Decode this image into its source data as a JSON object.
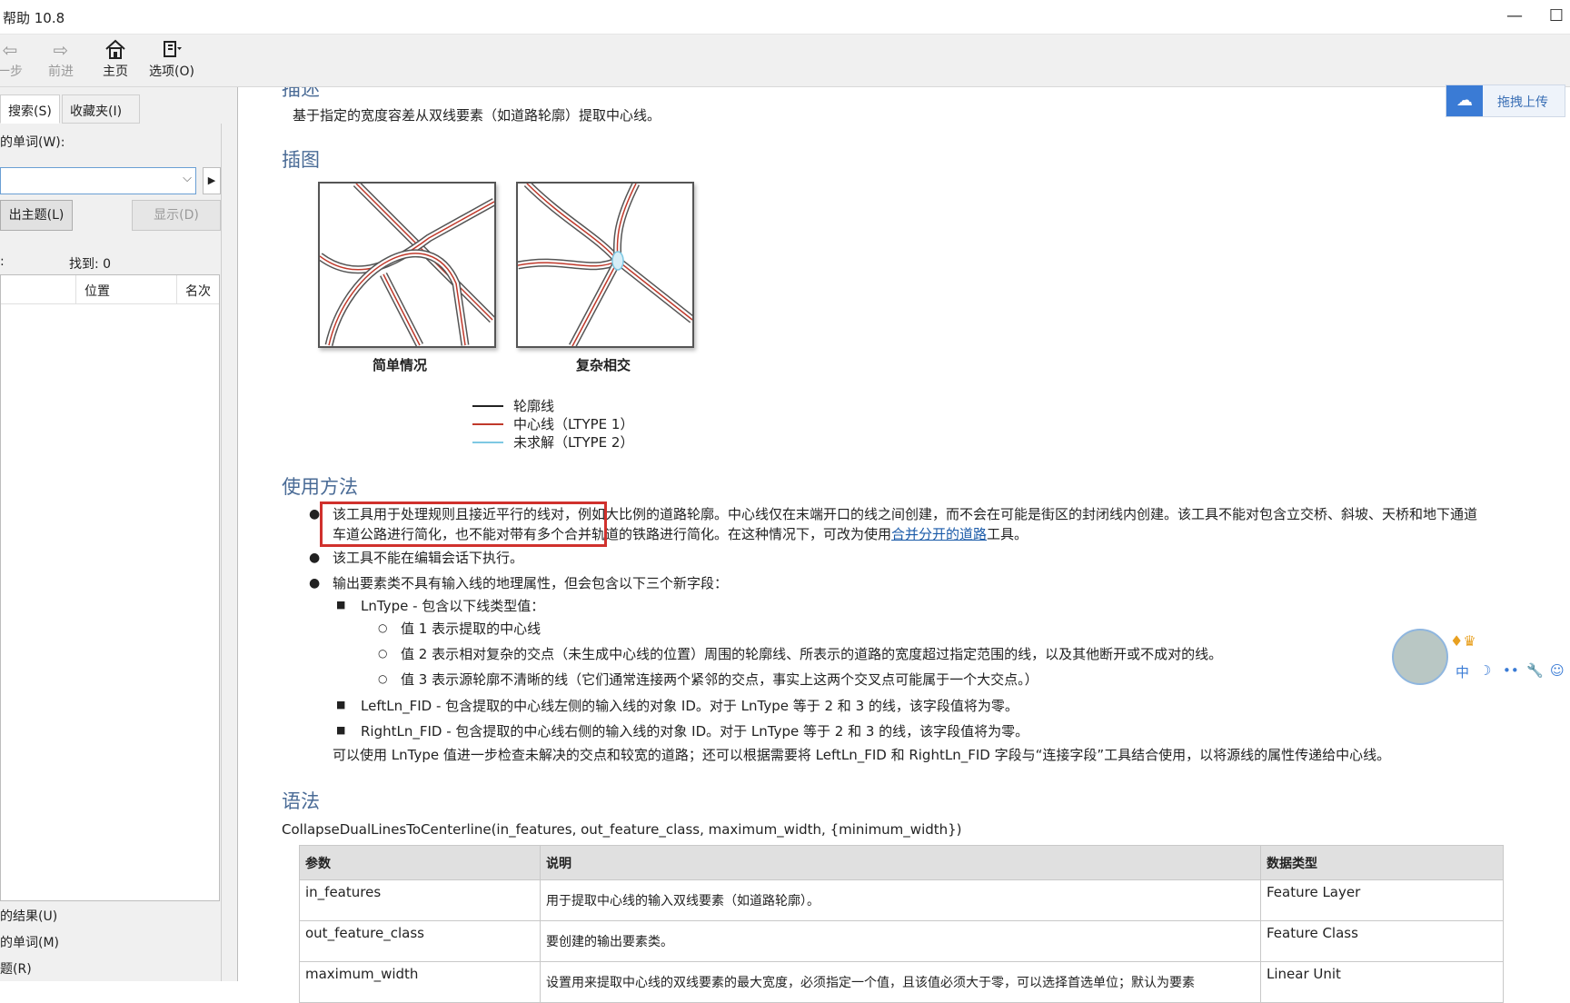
{
  "window": {
    "title": "帮助 10.8",
    "controls": [
      "—",
      "☐"
    ]
  },
  "toolbar": {
    "back": "一步",
    "forward": "前进",
    "home": "主页",
    "options": "选项(O)"
  },
  "left": {
    "tabs": [
      "搜索(S)",
      "收藏夹(I)"
    ],
    "word_label": "的单词(W):",
    "combo_value": "",
    "list_topics": "出主题(L)",
    "display": "显示(D)",
    "count_label": "找到: 0",
    "count_prefix": ":",
    "columns": [
      "位置",
      "名次"
    ],
    "options": [
      "的结果(U)",
      "的单词(M)",
      "题(R)"
    ]
  },
  "content": {
    "desc_heading": "描述",
    "desc_text": "基于指定的宽度容差从双线要素（如道路轮廓）提取中心线。",
    "illus_heading": "插图",
    "fig_captions": [
      "简单情况",
      "复杂相交"
    ],
    "legend": [
      {
        "label": "轮廓线",
        "color": "#222222"
      },
      {
        "label": "中心线（LTYPE 1）",
        "color": "#c0392b"
      },
      {
        "label": "未求解（LTYPE 2）",
        "color": "#7ec8e3"
      }
    ],
    "usage_heading": "使用方法",
    "usage_1a": "该工具用于处理规则且接近平行的线对，例如大比例的道路轮廓。中心线仅在末端开口的线之间创建，而不会在可能是街区的封闭线内创建。该工具不能对包含立交桥、斜坡、天桥和地下通道",
    "usage_1b": "车道公路进行简化，也不能对带有多个合并轨道的铁路进行简化。在这种情况下，可改为使用",
    "usage_1_link": "合并分开的道路",
    "usage_1_tail": "工具。",
    "usage_2": "该工具不能在编辑会话下执行。",
    "usage_3": "输出要素类不具有输入线的地理属性，但会包含以下三个新字段：",
    "lntype": "LnType - 包含以下线类型值：",
    "val1": "值 1 表示提取的中心线",
    "val2": "值 2 表示相对复杂的交点（未生成中心线的位置）周围的轮廓线、所表示的道路的宽度超过指定范围的线，以及其他断开或不成对的线。",
    "val3": "值 3 表示源轮廓不清晰的线（它们通常连接两个紧邻的交点，事实上这两个交叉点可能属于一个大交点。）",
    "leftln": "LeftLn_FID - 包含提取的中心线左侧的输入线的对象 ID。对于 LnType 等于 2 和 3 的线，该字段值将为零。",
    "rightln": "RightLn_FID - 包含提取的中心线右侧的输入线的对象 ID。对于 LnType 等于 2 和 3 的线，该字段值将为零。",
    "note": "可以使用 LnType 值进一步检查未解决的交点和较宽的道路；还可以根据需要将 LeftLn_FID 和 RightLn_FID 字段与“连接字段”工具结合使用，以将源线的属性传递给中心线。",
    "syntax_heading": "语法",
    "syntax": "CollapseDualLinesToCenterline(in_features, out_feature_class, maximum_width, {minimum_width})",
    "table": {
      "headers": [
        "参数",
        "说明",
        "数据类型"
      ],
      "rows": [
        [
          "in_features",
          "用于提取中心线的输入双线要素（如道路轮廓）。",
          "Feature Layer"
        ],
        [
          "out_feature_class",
          "要创建的输出要素类。",
          "Feature Class"
        ],
        [
          "maximum_width",
          "设置用来提取中心线的双线要素的最大宽度，必须指定一个值，且该值必须大于零，可以选择首选单位；默认为要素",
          "Linear Unit"
        ]
      ]
    }
  },
  "upload_widget": {
    "label": "拖拽上传"
  },
  "ime_widget": {
    "keys": [
      "中",
      "☽",
      "••",
      "🔧",
      "☺"
    ]
  }
}
